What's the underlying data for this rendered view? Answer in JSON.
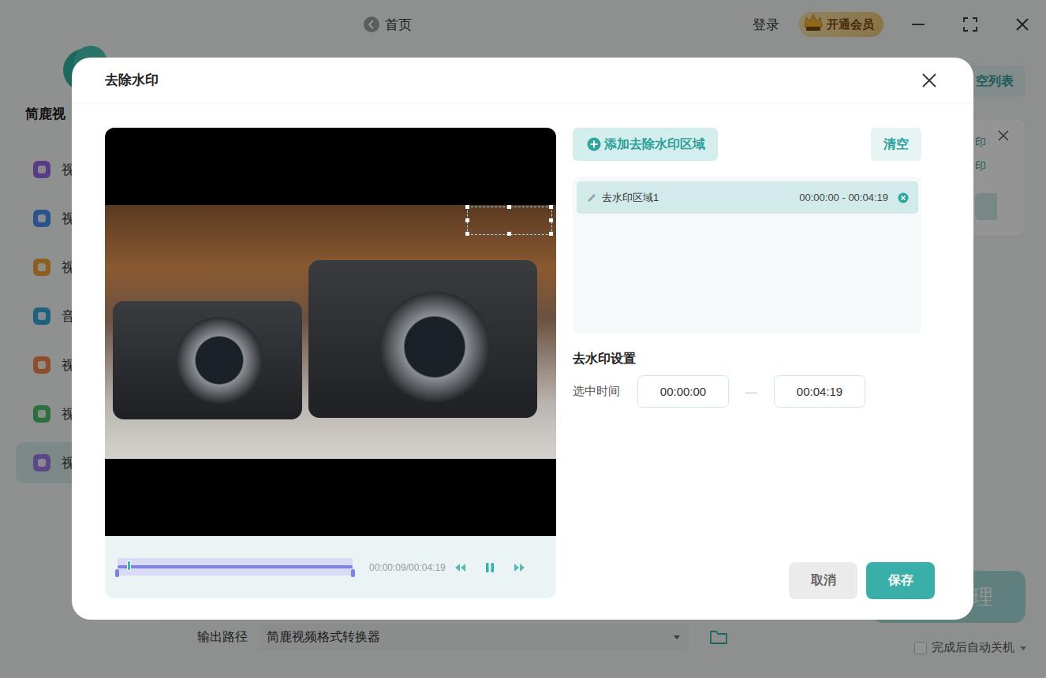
{
  "app": {
    "brand": "简鹿视",
    "home": "首页",
    "login": "登录",
    "vip": "开通会员",
    "sidebar": {
      "items": [
        {
          "label": "视",
          "selected": false,
          "color": "#9a6ae0"
        },
        {
          "label": "视",
          "selected": false,
          "color": "#4a8ef0"
        },
        {
          "label": "视",
          "selected": false,
          "color": "#f0a53a"
        },
        {
          "label": "音",
          "selected": false,
          "color": "#3aa8d8"
        },
        {
          "label": "视",
          "selected": false,
          "color": "#f08a4a"
        },
        {
          "label": "视",
          "selected": false,
          "color": "#4cc06a"
        },
        {
          "label": "视",
          "selected": true,
          "color": "#a07ae8"
        }
      ]
    },
    "clear_list": "空列表",
    "task_card": {
      "lines": [
        "印",
        "印"
      ]
    },
    "start_button": "理",
    "output": {
      "label": "输出路径",
      "path": "简鹿视频格式转换器"
    },
    "auto_shutdown": {
      "label": "完成后自动关机",
      "checked": false
    }
  },
  "dialog": {
    "title": "去除水印",
    "player": {
      "time": "00:00:09/00:04:19",
      "playing": true,
      "level": 0.035,
      "range_start": 0,
      "range_end": 1
    },
    "add_region": "添加去除水印区域",
    "clear": "清空",
    "regions": [
      {
        "name": "去水印区域1",
        "time": "00:00:00 - 00:04:19",
        "selected": true
      }
    ],
    "settings": {
      "heading": "去水印设置",
      "label": "选中时间",
      "start": "00:00:00",
      "separator": "—",
      "end": "00:04:19"
    },
    "buttons": {
      "cancel": "取消",
      "save": "保存"
    }
  }
}
